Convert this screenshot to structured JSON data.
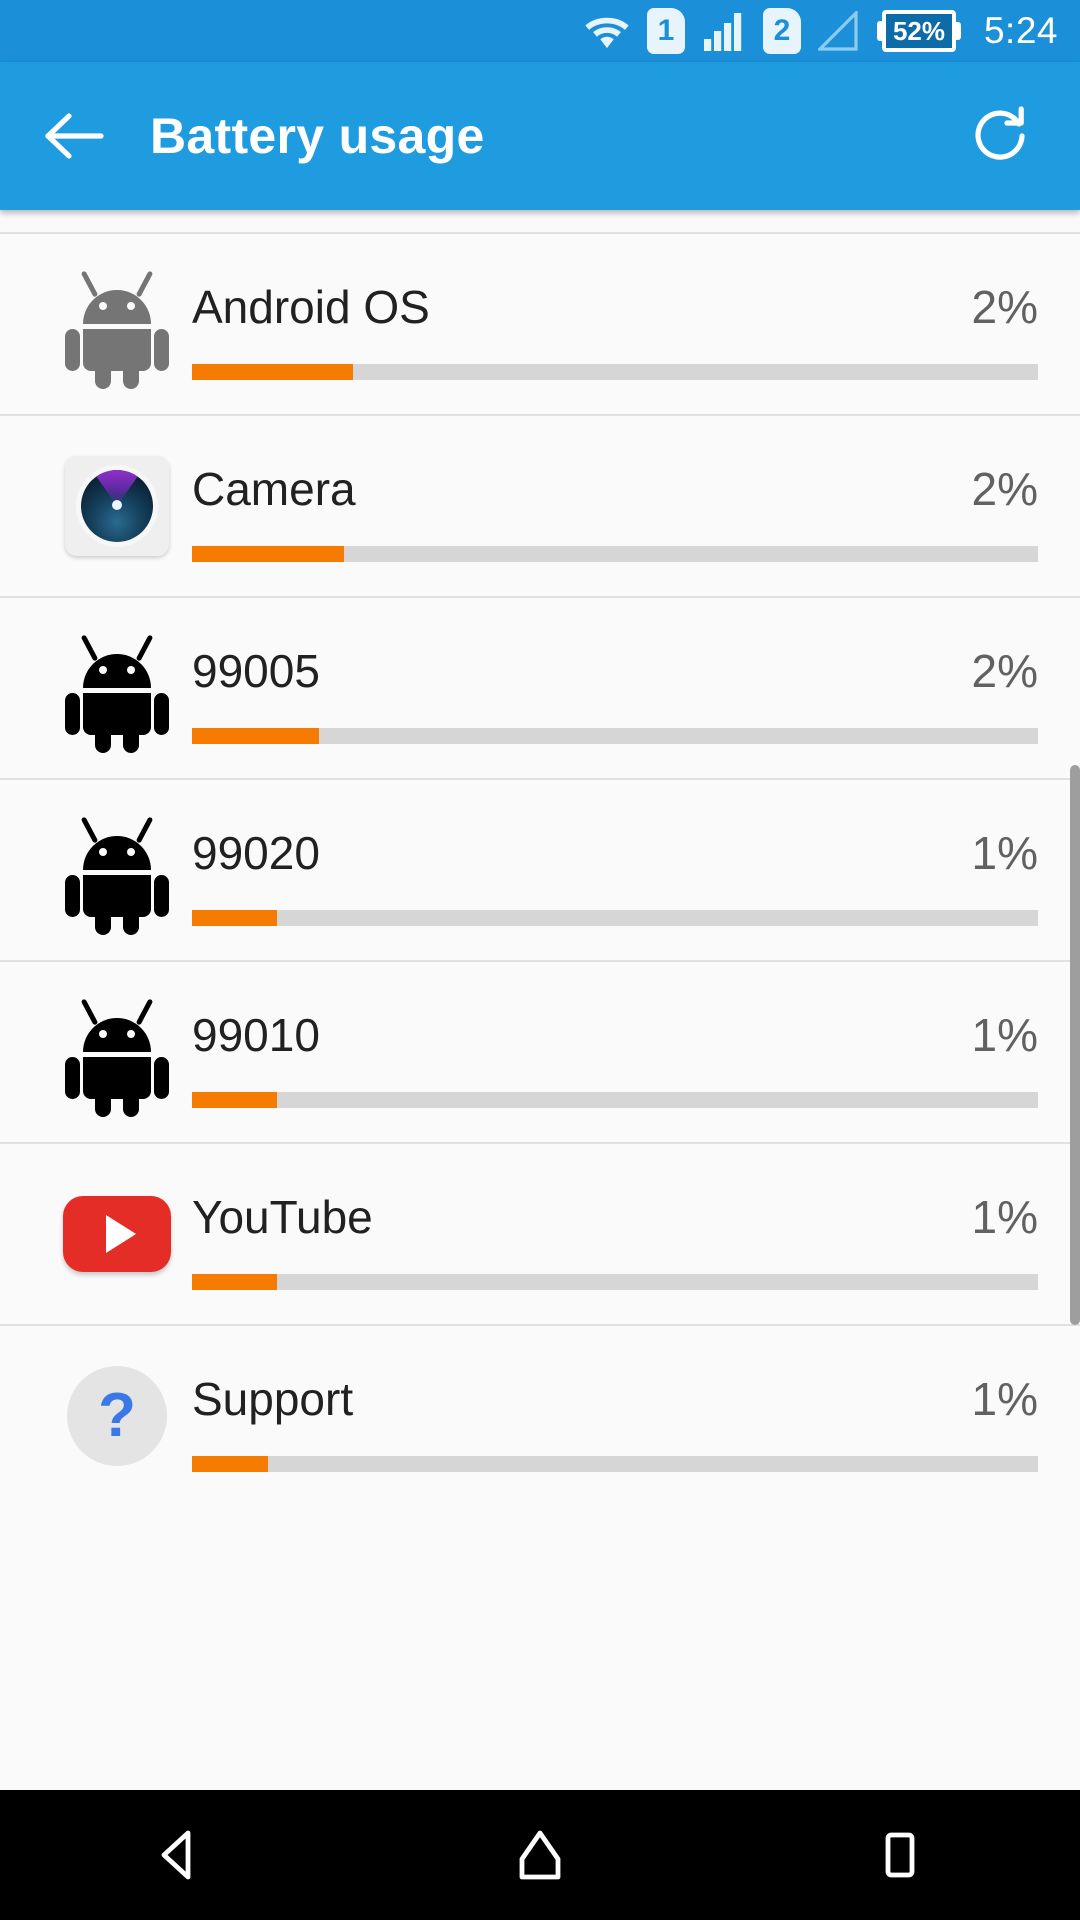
{
  "status_bar": {
    "wifi_icon": "wifi-icon",
    "sim1_label": "1",
    "signal1_icon": "signal-bars-icon",
    "sim2_label": "2",
    "signal2_icon": "signal-empty-icon",
    "battery_percent": "52%",
    "clock": "5:24",
    "background_color": "#1B8FD8"
  },
  "app_bar": {
    "back_icon": "arrow-left-icon",
    "title": "Battery usage",
    "refresh_icon": "refresh-icon",
    "background_color": "#1F9BE0"
  },
  "list": {
    "accent_color": "#F57C00",
    "track_color": "#d6d6d6",
    "rows": [
      {
        "name": "Android OS",
        "percent": "2%",
        "bar_fill": 19,
        "icon": "android-robot-gray-icon"
      },
      {
        "name": "Camera",
        "percent": "2%",
        "bar_fill": 18,
        "icon": "camera-app-icon"
      },
      {
        "name": "99005",
        "percent": "2%",
        "bar_fill": 15,
        "icon": "android-robot-black-icon"
      },
      {
        "name": "99020",
        "percent": "1%",
        "bar_fill": 10,
        "icon": "android-robot-black-icon"
      },
      {
        "name": "99010",
        "percent": "1%",
        "bar_fill": 10,
        "icon": "android-robot-black-icon"
      },
      {
        "name": "YouTube",
        "percent": "1%",
        "bar_fill": 10,
        "icon": "youtube-app-icon"
      },
      {
        "name": "Support",
        "percent": "1%",
        "bar_fill": 9,
        "icon": "support-help-icon"
      }
    ]
  },
  "nav_bar": {
    "back_icon": "nav-back-triangle-icon",
    "home_icon": "nav-home-icon",
    "recents_icon": "nav-recents-square-icon",
    "background_color": "#000000"
  }
}
